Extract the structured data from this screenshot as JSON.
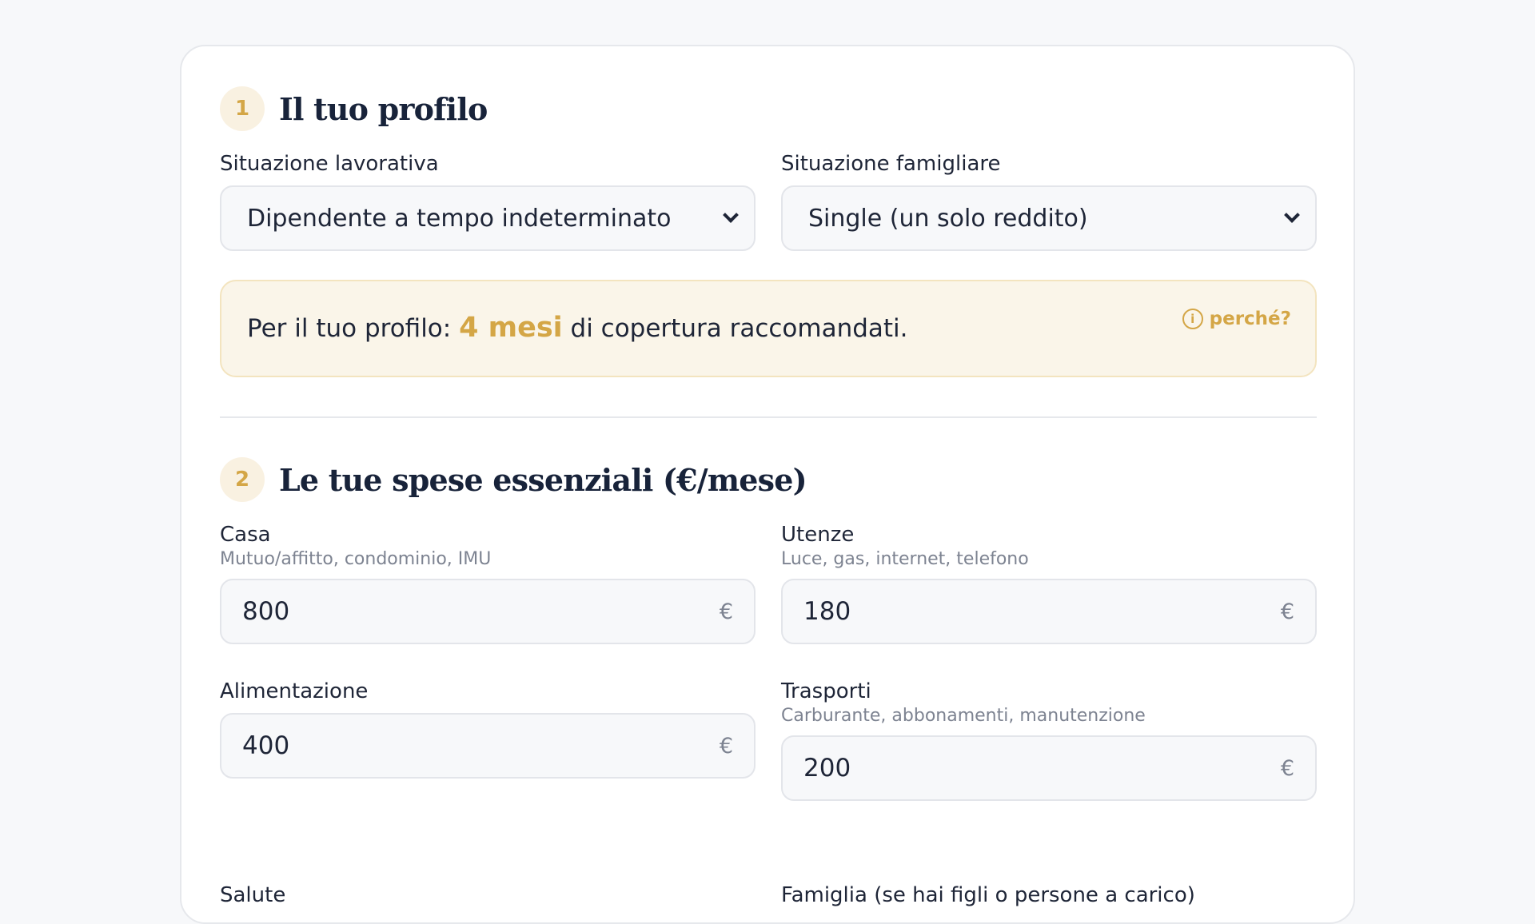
{
  "profile": {
    "step": "1",
    "title": "Il tuo profilo",
    "work_label": "Situazione lavorativa",
    "work_value": "Dipendente a tempo indeterminato",
    "family_label": "Situazione famigliare",
    "family_value": "Single (un solo reddito)",
    "recommendation_prefix": "Per il tuo profilo:",
    "recommendation_value": "4 mesi",
    "recommendation_suffix": "di copertura raccomandati.",
    "why_label": "perché?",
    "why_icon": "info-icon"
  },
  "expenses": {
    "step": "2",
    "title": "Le tue spese essenziali (€/mese)",
    "currency_symbol": "€",
    "fields": [
      {
        "label": "Casa",
        "hint": "Mutuo/affitto, condominio, IMU",
        "value": "800"
      },
      {
        "label": "Utenze",
        "hint": "Luce, gas, internet, telefono",
        "value": "180"
      },
      {
        "label": "Alimentazione",
        "hint": "",
        "value": "400"
      },
      {
        "label": "Trasporti",
        "hint": "Carburante, abbonamenti, manutenzione",
        "value": "200"
      },
      {
        "label": "Salute",
        "hint": "",
        "value": ""
      },
      {
        "label": "Famiglia (se hai figli o persone a carico)",
        "hint": "",
        "value": ""
      }
    ]
  },
  "colors": {
    "accent": "#d4a646",
    "text": "#1e2537",
    "muted": "#7d8391",
    "info_bg": "#faf5e9"
  }
}
